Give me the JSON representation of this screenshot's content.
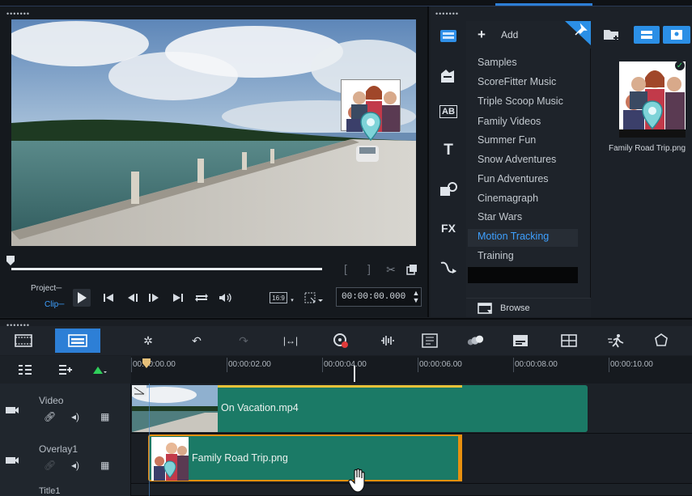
{
  "player": {
    "project_label": "Project",
    "clip_label": "Clip",
    "aspect_ratio": "16:9",
    "timecode": "00:00:00.000",
    "scrub_progress": 0.0
  },
  "library": {
    "add_label": "Add",
    "browse_label": "Browse",
    "folders": [
      "Samples",
      "ScoreFitter Music",
      "Triple Scoop Music",
      "Family Videos",
      "Summer Fun",
      "Snow Adventures",
      "Fun Adventures",
      "Cinemagraph",
      "Star Wars",
      "Motion Tracking",
      "Training"
    ],
    "selected_folder": "Motion Tracking",
    "side_icons": [
      "media-icon",
      "instant-project-icon",
      "transition-icon",
      "title-icon",
      "graphics-icon",
      "filter-icon",
      "path-icon"
    ],
    "side_icon_labels": {
      "transition": "AB",
      "title": "T",
      "filter": "FX"
    },
    "media_items": [
      {
        "caption": "Family Road Trip.png"
      }
    ]
  },
  "timeline": {
    "ruler": [
      "00:00:00.00",
      "00:00:02.00",
      "00:00:04.00",
      "00:00:06.00",
      "00:00:08.00",
      "00:00:10.00"
    ],
    "tracks": [
      {
        "name": "Video",
        "clip": "On Vacation.mp4"
      },
      {
        "name": "Overlay1",
        "clip": "Family Road Trip.png"
      },
      {
        "name": "Title1"
      }
    ]
  },
  "colors": {
    "accent": "#2d7fd6",
    "selected_text": "#3ea0ff",
    "clip_green": "#1b7a66",
    "clip_border_orange": "#e8900f"
  }
}
